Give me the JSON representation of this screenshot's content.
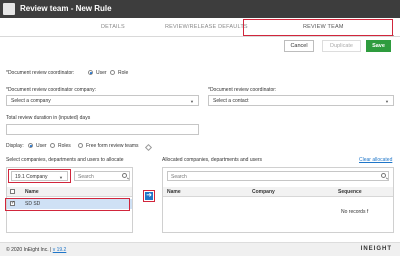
{
  "window": {
    "title": "Review team - New Rule"
  },
  "tabs": [
    {
      "label": "DETAILS"
    },
    {
      "label": "REVIEW/RELEASE DEFAULTS"
    },
    {
      "label": "REVIEW TEAM"
    }
  ],
  "toolbar": {
    "cancel": "Cancel",
    "duplicate": "Duplicate",
    "save": "Save"
  },
  "coordinator": {
    "label": "*Document review coordinator:",
    "options": [
      "User",
      "Role"
    ],
    "selected": "User"
  },
  "company_field": {
    "label": "*Document review coordinator company:",
    "value": "Select a company"
  },
  "coordinator_field": {
    "label": "*Document review coordinator:",
    "value": "Select a contact"
  },
  "duration": {
    "label": "Total review duration in (inputed) days",
    "value": ""
  },
  "display": {
    "label": "Display:",
    "options": [
      "User",
      "Roles",
      "Free form review teams"
    ],
    "selected": "User"
  },
  "left_panel": {
    "title": "Select companies, departments and users to allocate",
    "company_select": "19.1 Company",
    "search_placeholder": "Search",
    "column": "Name",
    "rows": [
      {
        "name": "SD SD",
        "checked": true
      }
    ]
  },
  "right_panel": {
    "title": "Allocated companies, departments and users",
    "clear_link": "Clear allocated",
    "search_placeholder": "Search",
    "columns": [
      "Name",
      "Company",
      "Sequence"
    ],
    "empty_text": "No records f"
  },
  "footer": {
    "copyright": "© 2020 InEight Inc.",
    "version": "v 19.2",
    "logo": "INEIGHT"
  },
  "colors": {
    "titlebar": "#3d3d3d",
    "save": "#2e9c3e",
    "accent": "#1f76c9",
    "highlight": "#d1263c"
  }
}
